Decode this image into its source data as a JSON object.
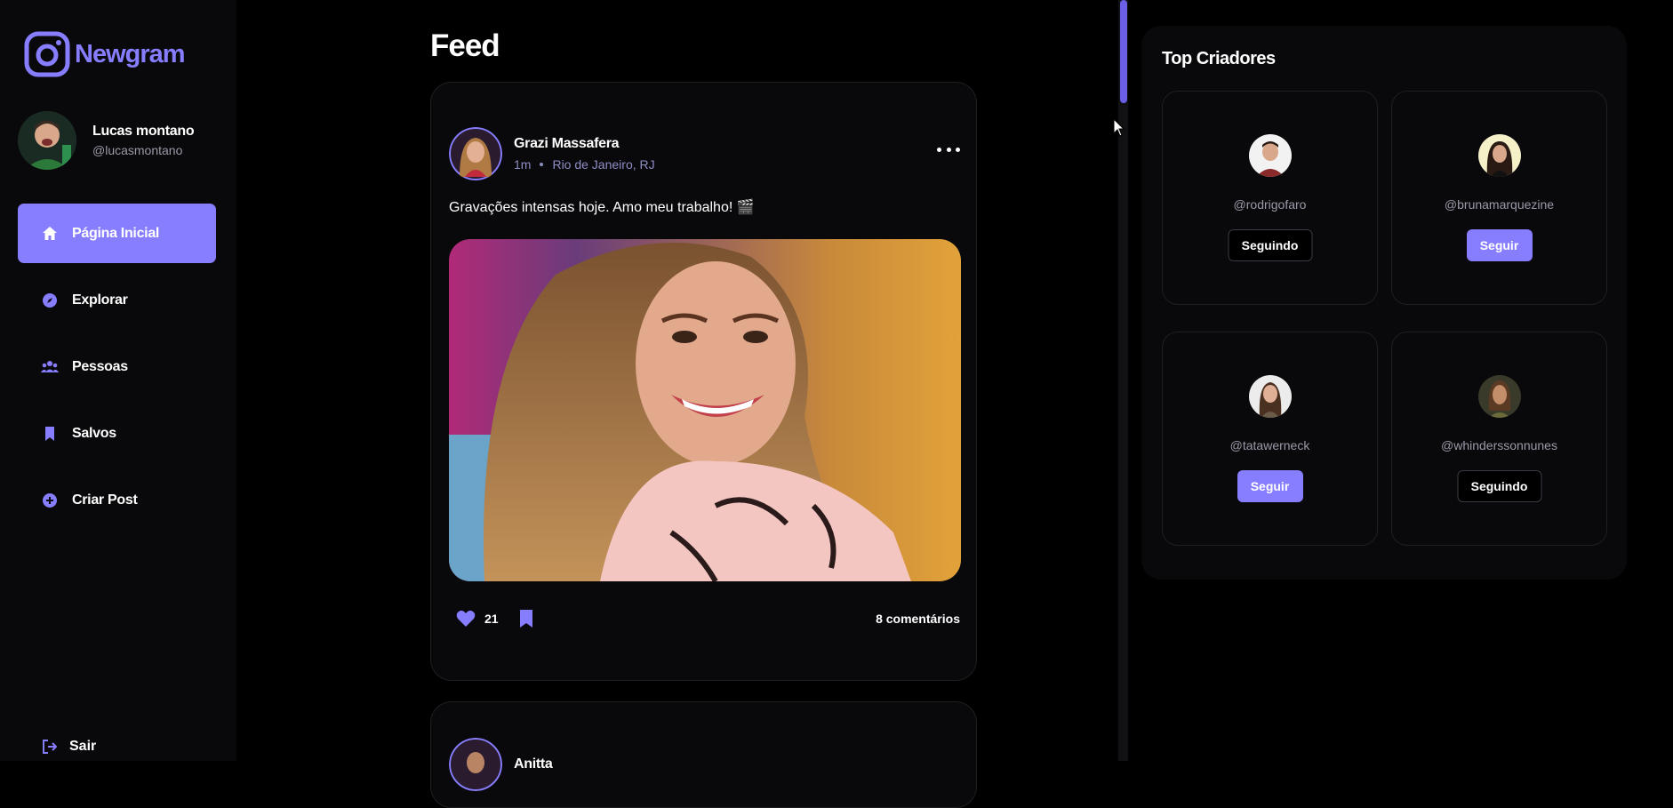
{
  "app": {
    "name": "Newgram"
  },
  "user": {
    "name": "Lucas montano",
    "handle": "@lucasmontano"
  },
  "nav": [
    {
      "label": "Página Inicial",
      "icon": "home-icon",
      "active": true
    },
    {
      "label": "Explorar",
      "icon": "compass-icon",
      "active": false
    },
    {
      "label": "Pessoas",
      "icon": "people-icon",
      "active": false
    },
    {
      "label": "Salvos",
      "icon": "bookmark-icon",
      "active": false
    },
    {
      "label": "Criar Post",
      "icon": "plus-circle-icon",
      "active": false
    }
  ],
  "logout": {
    "label": "Sair"
  },
  "feed": {
    "title": "Feed",
    "posts": [
      {
        "author": "Grazi Massafera",
        "time": "1m",
        "location": "Rio de Janeiro, RJ",
        "caption": "Gravações intensas hoje. Amo meu trabalho! 🎬",
        "likes": "21",
        "comments": "8 comentários"
      },
      {
        "author": "Anitta"
      }
    ]
  },
  "top_creators": {
    "title": "Top Criadores",
    "creators": [
      {
        "handle": "@rodrigofaro",
        "button": "Seguindo",
        "following": true
      },
      {
        "handle": "@brunamarquezine",
        "button": "Seguir",
        "following": false
      },
      {
        "handle": "@tatawerneck",
        "button": "Seguir",
        "following": false
      },
      {
        "handle": "@whinderssonnunes",
        "button": "Seguindo",
        "following": true
      }
    ]
  },
  "colors": {
    "accent": "#877eff",
    "background": "#000000",
    "panel": "#09090b",
    "muted": "#9a9aa8"
  }
}
